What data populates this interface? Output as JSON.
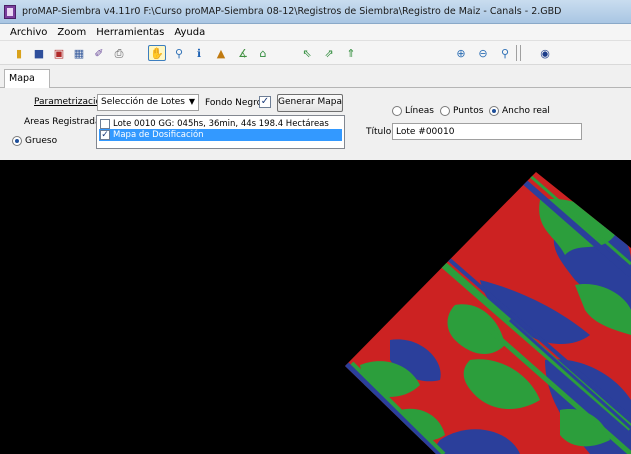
{
  "window": {
    "title": "proMAP-Siembra v4.11r0   F:\\Curso proMAP-Siembra 08-12\\Registros de Siembra\\Registro de Maiz - Canals - 2.GBD"
  },
  "menu": [
    "Archivo",
    "Zoom",
    "Herramientas",
    "Ayuda"
  ],
  "toolbar": {
    "icons": [
      "open-folder-icon",
      "save-icon",
      "export-icon",
      "calculator-icon",
      "brush-icon",
      "print-icon",
      "hand-pan-icon",
      "magnifier-icon",
      "info-icon",
      "measure-icon",
      "compass-icon",
      "home-icon",
      "arrow-up-left-icon",
      "arrow-up-right-icon",
      "arrow-up-icon",
      "zoom-in-icon",
      "zoom-out-icon",
      "zoom-extent-icon",
      "globe-icon"
    ]
  },
  "tabs": [
    "Mapa"
  ],
  "panel": {
    "parametrizacion_label": "Parametrización",
    "parametrizacion_value": "Selección de Lotes",
    "fondo_negro_label": "Fondo Negro",
    "generar_button": "Generar Mapa",
    "areas_label": "Areas Registradas",
    "grueso_label": "Grueso",
    "list_items": [
      {
        "label": "Lote 0010 GG: 045hs, 36min, 44s 198.4 Hectáreas",
        "checked": false,
        "selected": false
      },
      {
        "label": "Mapa de Dosificación",
        "checked": true,
        "selected": true
      }
    ],
    "view_options": {
      "lineas": "Líneas",
      "puntos": "Puntos",
      "ancho_real": "Ancho real",
      "selected": "ancho_real"
    },
    "titulo_label": "Título",
    "titulo_value": "Lote #00010"
  },
  "map": {
    "colors": {
      "high": "#cc2222",
      "mid": "#2c9e3c",
      "low": "#2b3f9b",
      "background": "#000000"
    }
  }
}
